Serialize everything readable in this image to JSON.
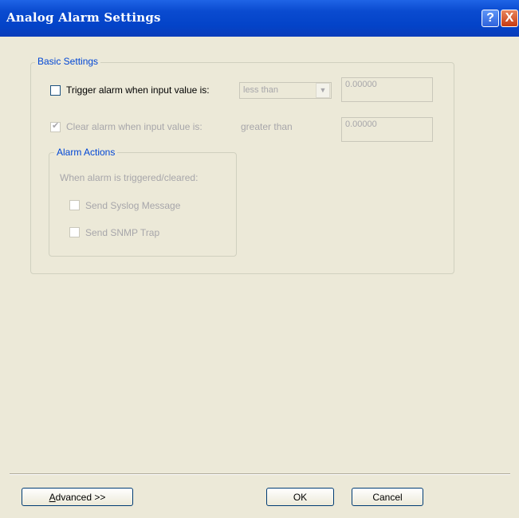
{
  "window": {
    "title": "Analog Alarm Settings",
    "help_symbol": "?",
    "close_symbol": "X"
  },
  "basic": {
    "legend": "Basic Settings",
    "trigger_label": "Trigger alarm when input value is:",
    "trigger_op": "less than",
    "trigger_value": "0.00000",
    "clear_label": "Clear alarm when input value is:",
    "clear_op": "greater than",
    "clear_value": "0.00000"
  },
  "actions": {
    "legend": "Alarm Actions",
    "hint": "When alarm is triggered/cleared:",
    "syslog": "Send Syslog Message",
    "snmp": "Send SNMP Trap"
  },
  "buttons": {
    "advanced_first": "A",
    "advanced_rest": "dvanced >>",
    "ok": "OK",
    "cancel": "Cancel"
  },
  "icons": {
    "check": "✔",
    "dropdown": "▼"
  }
}
